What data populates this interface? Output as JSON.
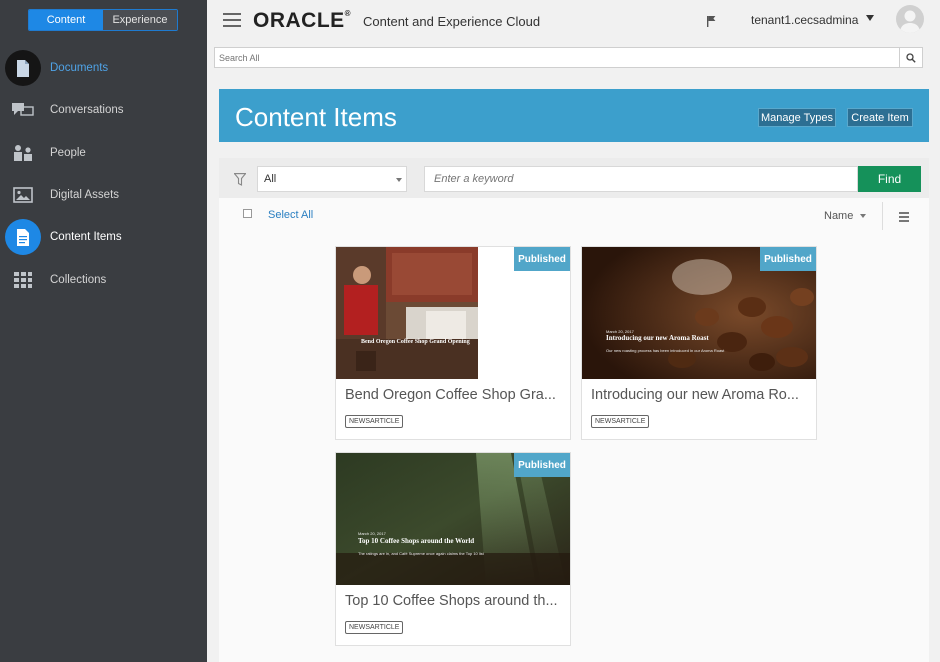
{
  "switcher": {
    "content": "Content",
    "experience": "Experience"
  },
  "sidebar": {
    "items": [
      {
        "label": "Documents",
        "icon": "document-icon",
        "state": "active-blue-text"
      },
      {
        "label": "Conversations",
        "icon": "conversations-icon",
        "state": "normal"
      },
      {
        "label": "People",
        "icon": "people-icon",
        "state": "normal"
      },
      {
        "label": "Digital Assets",
        "icon": "image-icon",
        "state": "normal"
      },
      {
        "label": "Content Items",
        "icon": "content-items-icon",
        "state": "selected"
      },
      {
        "label": "Collections",
        "icon": "collections-icon",
        "state": "normal"
      }
    ]
  },
  "header": {
    "logo": "ORACLE",
    "logo_mark": "®",
    "product": "Content and Experience Cloud",
    "user": "tenant1.cecsadmina"
  },
  "search": {
    "placeholder": "Search All"
  },
  "banner": {
    "title": "Content Items",
    "manage_types": "Manage Types",
    "create_item": "Create Item"
  },
  "filter": {
    "type_value": "All",
    "keyword_placeholder": "Enter a keyword",
    "find": "Find"
  },
  "toolbar": {
    "select_all": "Select All",
    "sort": "Name"
  },
  "cards": [
    {
      "status": "Published",
      "title": "Bend Oregon Coffee Shop Gra...",
      "type": "NEWSARTICLE",
      "overlay_title": "Bend Oregon Coffee Shop Grand Opening",
      "overlay_date": "",
      "overlay_sub": ""
    },
    {
      "status": "Published",
      "title": "Introducing our new Aroma Ro...",
      "type": "NEWSARTICLE",
      "overlay_title": "Introducing our new Aroma Roast",
      "overlay_date": "March 20, 2017",
      "overlay_sub": "Our new roasting process has been introduced in our Aroma Roast"
    },
    {
      "status": "Published",
      "title": "Top 10 Coffee Shops around th...",
      "type": "NEWSARTICLE",
      "overlay_title": "Top 10 Coffee Shops around the World",
      "overlay_date": "March 20, 2017",
      "overlay_sub": "The ratings are in, and Café Supreme once again claims the Top 10 list"
    }
  ],
  "colors": {
    "sidebar_bg": "#3a3d41",
    "accent_blue": "#1e88e5",
    "banner": "#3c9fcc",
    "find_green": "#15915a",
    "badge": "#51a6c9"
  }
}
